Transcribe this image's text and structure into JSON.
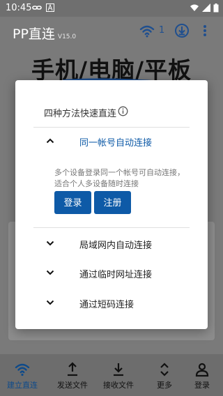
{
  "status_bar": {
    "time": "10:45"
  },
  "app_bar": {
    "title": "PP直连",
    "version": "V15.0",
    "connection_count": "1"
  },
  "hero": {
    "text": "手机/电脑/平板"
  },
  "dialog": {
    "title": "四种方法快速直连",
    "methods": [
      {
        "label": "同一帐号自动连接",
        "expanded": true,
        "description": "多个设备登录同一个帐号可自动连接，适合个人多设备随时连接",
        "buttons": {
          "login": "登录",
          "register": "注册"
        }
      },
      {
        "label": "局域网内自动连接",
        "expanded": false
      },
      {
        "label": "通过临时网址连接",
        "expanded": false
      },
      {
        "label": "通过短码连接",
        "expanded": false
      }
    ]
  },
  "bottom_nav": [
    {
      "label": "建立直连",
      "icon": "wifi-icon",
      "active": true
    },
    {
      "label": "发送文件",
      "icon": "upload-icon",
      "active": false
    },
    {
      "label": "接收文件",
      "icon": "download-icon",
      "active": false
    },
    {
      "label": "更多",
      "icon": "expand-icon",
      "active": false
    },
    {
      "label": "登录",
      "icon": "person-icon",
      "active": false
    }
  ],
  "colors": {
    "accent": "#0e5aa7",
    "active_nav": "#0e4a8a",
    "scrim": "#7a7a7a"
  }
}
